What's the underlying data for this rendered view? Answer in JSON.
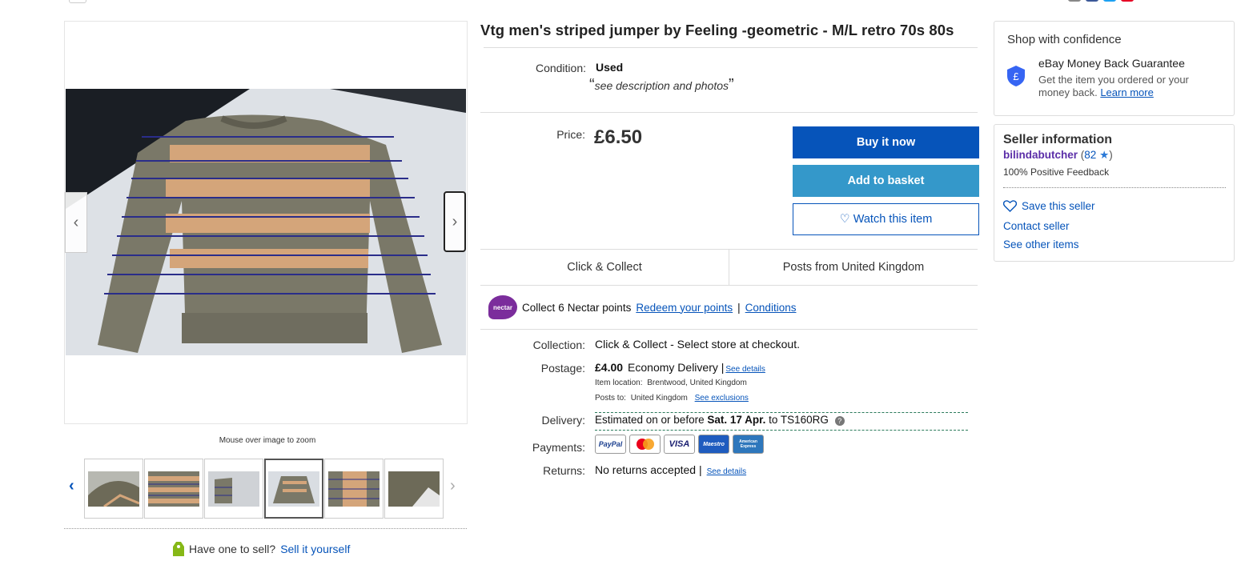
{
  "listing": {
    "title": "Vtg men's striped jumper by Feeling -geometric - M/L retro 70s 80s"
  },
  "gallery": {
    "zoom_hint": "Mouse over image to zoom",
    "prev_glyph": "‹",
    "next_glyph": "›",
    "thumbnail_count": 6,
    "active_thumbnail": 4
  },
  "sell": {
    "prompt": "Have one to sell?",
    "link": "Sell it yourself"
  },
  "condition": {
    "label": "Condition:",
    "value": "Used",
    "note": "see description and photos",
    "open_quote": "“",
    "close_quote": "”"
  },
  "price": {
    "label": "Price:",
    "value": "£6.50"
  },
  "actions": {
    "buy": "Buy it now",
    "basket": "Add to basket",
    "watch": "Watch this item"
  },
  "shipping_tabs": {
    "left": "Click & Collect",
    "right": "Posts from United Kingdom"
  },
  "nectar": {
    "logo_text": "nectar",
    "collect_prefix": "Collect",
    "points": "6",
    "collect_suffix": "Nectar points",
    "redeem": "Redeem your points",
    "divider": "|",
    "conditions": "Conditions"
  },
  "details": {
    "collection_label": "Collection:",
    "collection_value": "Click & Collect - Select store at checkout.",
    "postage_label": "Postage:",
    "postage_price": "£4.00",
    "postage_method": "Economy Delivery |",
    "postage_details": "See details",
    "item_location_label": "Item location:",
    "item_location": "Brentwood, United Kingdom",
    "posts_to_label": "Posts to:",
    "posts_to": "United Kingdom",
    "see_exclusions": "See exclusions",
    "delivery_label": "Delivery:",
    "delivery_prefix": "Estimated on or before",
    "delivery_date": "Sat. 17 Apr.",
    "delivery_suffix": "to TS160RG",
    "payments_label": "Payments:",
    "payment_methods": [
      "PayPal",
      "Mastercard",
      "VISA",
      "Maestro",
      "American Express"
    ],
    "returns_label": "Returns:",
    "returns_value": "No returns accepted |",
    "returns_details": "See details"
  },
  "confidence": {
    "heading": "Shop with confidence",
    "guarantee_title": "eBay Money Back Guarantee",
    "guarantee_text": "Get the item you ordered or your money back.",
    "learn_more": "Learn more"
  },
  "seller": {
    "heading": "Seller information",
    "name": "bilindabutcher",
    "feedback_score": "82",
    "positive": "100% Positive Feedback",
    "save": "Save this seller",
    "contact": "Contact seller",
    "other_items": "See other items"
  },
  "colors": {
    "brand_blue": "#0654ba",
    "basket_blue": "#3498ca",
    "seller_purple": "#5b2ea8",
    "nectar_purple": "#7b2d9c"
  }
}
